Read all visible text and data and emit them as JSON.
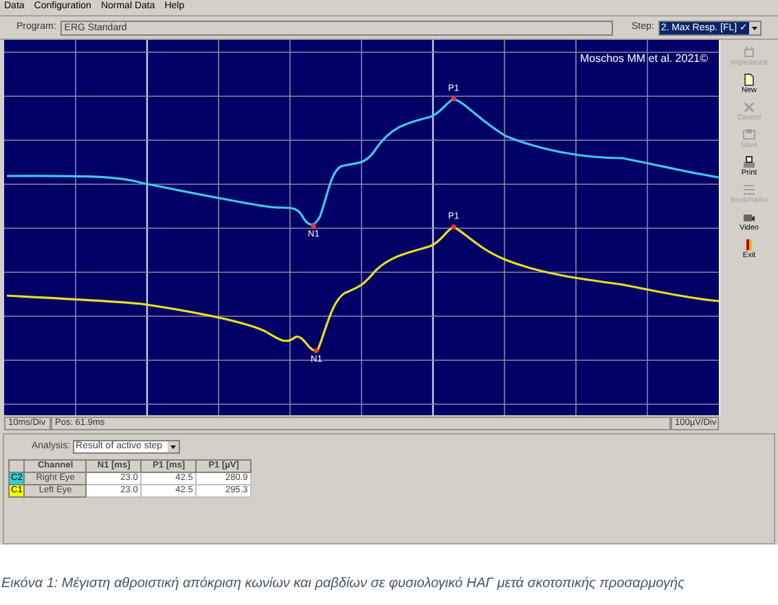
{
  "menu": [
    "Data",
    "Configuration",
    "Normal Data",
    "Help"
  ],
  "program_bar": {
    "program_label": "Program:",
    "program": "ERG Standard",
    "step_label": "Step:",
    "step": "2. Max Resp. [FL] ✓"
  },
  "plot": {
    "credit": "Moschos MM et al. 2021©",
    "traces": [
      {
        "kind": "cyan",
        "peak_label": "P1",
        "trough_label": "N1"
      },
      {
        "kind": "yellow",
        "peak_label": "P1",
        "trough_label": "N1"
      }
    ]
  },
  "toolbar": [
    {
      "label": "Impedance",
      "kind": "impedance",
      "disabled": true
    },
    {
      "label": "New",
      "kind": "new",
      "disabled": false
    },
    {
      "label": "Cancel",
      "kind": "cancel",
      "disabled": true
    },
    {
      "label": "Save",
      "kind": "save",
      "disabled": true
    },
    {
      "label": "Print",
      "kind": "print",
      "disabled": false
    },
    {
      "label": "Bookmarks",
      "kind": "bookmarks",
      "disabled": true
    },
    {
      "label": "Video",
      "kind": "video",
      "disabled": false
    },
    {
      "label": "Exit",
      "kind": "exit",
      "disabled": false
    }
  ],
  "status": {
    "time_scale": "10ms/Div",
    "position": "Pos: 61.9ms",
    "amplitude_scale": "100µV/Div"
  },
  "analysis": {
    "label": "Analysis:",
    "value": "Result of active step"
  },
  "table": {
    "columns": [
      "",
      "Channel",
      "N1 [ms]",
      "P1 [ms]",
      "P1 [µV]"
    ],
    "rows": [
      {
        "code": "C2",
        "color": "#33cccc",
        "channel": "Right Eye",
        "n1_ms": "23.0",
        "p1_ms": "42.5",
        "p1_uv": "280.9"
      },
      {
        "code": "C1",
        "color": "#ffff00",
        "channel": "Left Eye",
        "n1_ms": "23.0",
        "p1_ms": "42.5",
        "p1_uv": "295.3"
      }
    ]
  },
  "caption": "Εικόνα 1: Μέγιστη αθροιστική απόκριση κωνίων και ραβδίων σε φυσιολογικό ΗΑΓ μετά σκοτοπικής προσαρμογής"
}
